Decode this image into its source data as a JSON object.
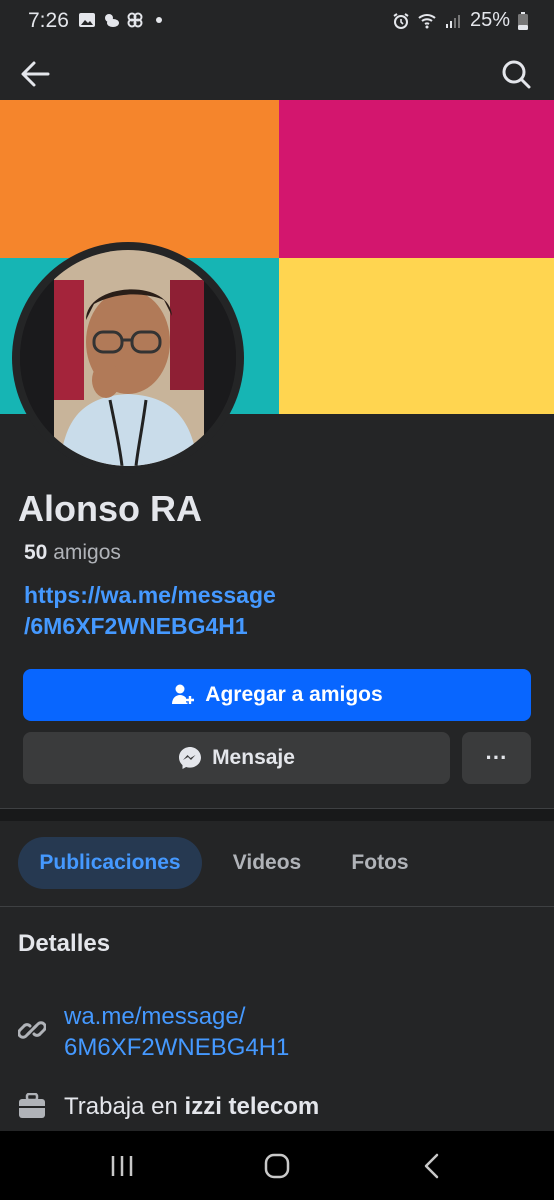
{
  "status": {
    "time": "7:26",
    "battery": "25%",
    "left_icons": [
      "image-icon",
      "weather-icon",
      "pinwheel-icon",
      "dot-icon"
    ],
    "right_icons": [
      "alarm-icon",
      "wifi-icon",
      "signal-icon",
      "battery-icon"
    ]
  },
  "cover": {
    "colors": [
      "#f5852c",
      "#d3166e",
      "#16b5b4",
      "#ffd550"
    ]
  },
  "profile": {
    "name": "Alonso RA",
    "friends_count": "50",
    "friends_label": "amigos",
    "link_line1": "https://wa.me/message",
    "link_line2": "/6M6XF2WNEBG4H1"
  },
  "actions": {
    "add_friend": "Agregar a amigos",
    "message": "Mensaje",
    "more": "···"
  },
  "tabs": [
    {
      "label": "Publicaciones",
      "active": true
    },
    {
      "label": "Videos",
      "active": false
    },
    {
      "label": "Fotos",
      "active": false
    }
  ],
  "details": {
    "title": "Detalles",
    "link_line1": "wa.me/message/",
    "link_line2": "6M6XF2WNEBG4H1",
    "work_prefix": "Trabaja en",
    "work_company": "izzi telecom"
  },
  "colors": {
    "background": "#242526",
    "accent": "#0866ff",
    "link": "#4599ff",
    "secondary_button": "#3a3b3c"
  }
}
